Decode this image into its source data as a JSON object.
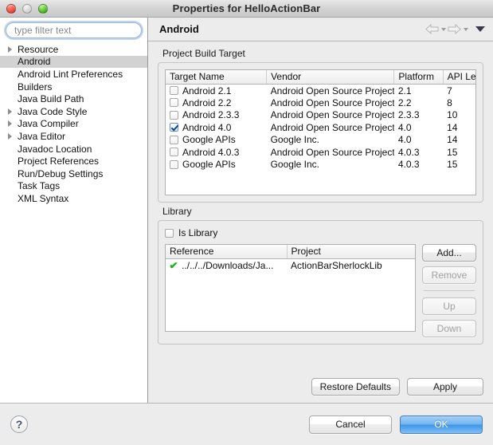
{
  "window": {
    "title": "Properties for HelloActionBar",
    "traffic_lights": [
      "close-button",
      "minimize-button",
      "zoom-button"
    ]
  },
  "sidebar": {
    "filter": {
      "placeholder": "type filter text",
      "value": ""
    },
    "items": [
      {
        "label": "Resource",
        "expandable": true,
        "selected": false
      },
      {
        "label": "Android",
        "expandable": false,
        "selected": true
      },
      {
        "label": "Android Lint Preferences",
        "expandable": false,
        "selected": false
      },
      {
        "label": "Builders",
        "expandable": false,
        "selected": false
      },
      {
        "label": "Java Build Path",
        "expandable": false,
        "selected": false
      },
      {
        "label": "Java Code Style",
        "expandable": true,
        "selected": false
      },
      {
        "label": "Java Compiler",
        "expandable": true,
        "selected": false
      },
      {
        "label": "Java Editor",
        "expandable": true,
        "selected": false
      },
      {
        "label": "Javadoc Location",
        "expandable": false,
        "selected": false
      },
      {
        "label": "Project References",
        "expandable": false,
        "selected": false
      },
      {
        "label": "Run/Debug Settings",
        "expandable": false,
        "selected": false
      },
      {
        "label": "Task Tags",
        "expandable": false,
        "selected": false
      },
      {
        "label": "XML Syntax",
        "expandable": false,
        "selected": false
      }
    ]
  },
  "content": {
    "title": "Android",
    "nav": {
      "back": "back-arrow",
      "forward": "forward-arrow",
      "menu": "view-menu-caret"
    },
    "build_target": {
      "group_title": "Project Build Target",
      "columns": [
        "Target Name",
        "Vendor",
        "Platform",
        "API Le"
      ],
      "rows": [
        {
          "checked": false,
          "name": "Android 2.1",
          "vendor": "Android Open Source Project",
          "platform": "2.1",
          "api": "7"
        },
        {
          "checked": false,
          "name": "Android 2.2",
          "vendor": "Android Open Source Project",
          "platform": "2.2",
          "api": "8"
        },
        {
          "checked": false,
          "name": "Android 2.3.3",
          "vendor": "Android Open Source Project",
          "platform": "2.3.3",
          "api": "10"
        },
        {
          "checked": true,
          "name": "Android 4.0",
          "vendor": "Android Open Source Project",
          "platform": "4.0",
          "api": "14"
        },
        {
          "checked": false,
          "name": "Google APIs",
          "vendor": "Google Inc.",
          "platform": "4.0",
          "api": "14"
        },
        {
          "checked": false,
          "name": "Android 4.0.3",
          "vendor": "Android Open Source Project",
          "platform": "4.0.3",
          "api": "15"
        },
        {
          "checked": false,
          "name": "Google APIs",
          "vendor": "Google Inc.",
          "platform": "4.0.3",
          "api": "15"
        }
      ]
    },
    "library": {
      "group_title": "Library",
      "is_library": {
        "label": "Is Library",
        "checked": false
      },
      "columns": [
        "Reference",
        "Project"
      ],
      "rows": [
        {
          "status": "ok",
          "reference": "../../../Downloads/Ja...",
          "project": "ActionBarSherlockLib"
        }
      ],
      "buttons": [
        {
          "label": "Add...",
          "enabled": true
        },
        {
          "label": "Remove",
          "enabled": false
        },
        {
          "label": "Up",
          "enabled": false
        },
        {
          "label": "Down",
          "enabled": false
        }
      ]
    },
    "apply_row": [
      {
        "label": "Restore Defaults",
        "enabled": true
      },
      {
        "label": "Apply",
        "enabled": true
      }
    ]
  },
  "footer": {
    "help": "?",
    "buttons": [
      {
        "label": "Cancel",
        "default": false
      },
      {
        "label": "OK",
        "default": true
      }
    ]
  }
}
